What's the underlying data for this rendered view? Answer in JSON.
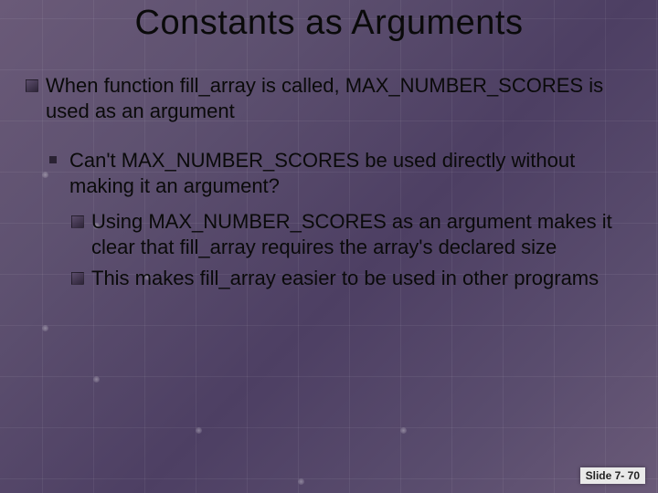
{
  "title": "Constants as Arguments",
  "bullets": {
    "lvl1": "When function fill_array is called, MAX_NUMBER_SCORES is used as an argument",
    "lvl2": "Can't MAX_NUMBER_SCORES be used directly without making it an argument?",
    "lvl3a": "Using MAX_NUMBER_SCORES as an argument makes it clear that fill_array requires the array's declared size",
    "lvl3b": "This makes fill_array easier to be used in other programs"
  },
  "footer": "Slide 7- 70"
}
